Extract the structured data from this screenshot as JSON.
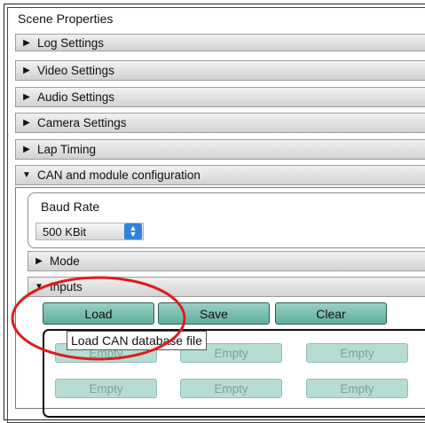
{
  "title": "Scene Properties",
  "sections": {
    "log": "Log Settings",
    "video": "Video Settings",
    "audio": "Audio Settings",
    "camera": "Camera Settings",
    "lap": "Lap Timing",
    "can": "CAN and module configuration"
  },
  "can": {
    "baud_label": "Baud Rate",
    "baud_value": "500 KBit",
    "mode_label": "Mode",
    "inputs_label": "Inputs",
    "buttons": {
      "load": "Load",
      "save": "Save",
      "clear": "Clear"
    },
    "tooltip": "Load CAN database file",
    "cells": [
      "Empty",
      "Empty",
      "Empty",
      "Empty",
      "Empty",
      "Empty"
    ]
  },
  "icons": {
    "collapsed": "triangle-right",
    "expanded": "triangle-down",
    "spinner": "up-down-arrows"
  },
  "colors": {
    "button_fill": "#7fc0b2",
    "cell_fill": "#b7dcd4",
    "annotation": "#e01b1b",
    "spinner": "#2f83d8"
  }
}
